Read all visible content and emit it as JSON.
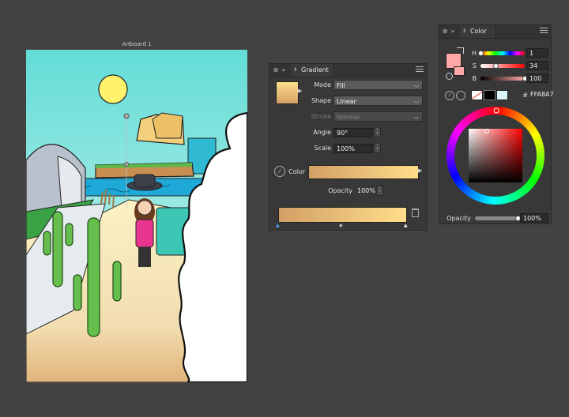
{
  "artboard": {
    "title": "Artboard 1"
  },
  "gradient_panel": {
    "tab_label": "Gradient",
    "mode_label": "Mode",
    "mode_value": "Fill",
    "shape_label": "Shape",
    "shape_value": "Linear",
    "stroke_label": "Stroke",
    "stroke_value": "Normal",
    "angle_label": "Angle",
    "angle_value": "90°",
    "scale_label": "Scale",
    "scale_value": "100%",
    "color_label": "Color",
    "opacity_label": "Opacity",
    "opacity_value": "100%",
    "gradient_start": "#D2A066",
    "gradient_end": "#FFDD8A"
  },
  "color_panel": {
    "tab_label": "Color",
    "h_label": "H",
    "h_value": "1",
    "s_label": "S",
    "s_value": "34",
    "b_label": "B",
    "b_value": "100",
    "hex_prefix": "#",
    "hex_value": "FFA8A7",
    "opacity_label": "Opacity",
    "opacity_value": "100%",
    "current_color": "#FFA8A7",
    "hue_fraction": 0.003,
    "saturation_fraction": 0.34,
    "brightness_fraction": 1.0,
    "opacity_fraction": 1.0
  }
}
